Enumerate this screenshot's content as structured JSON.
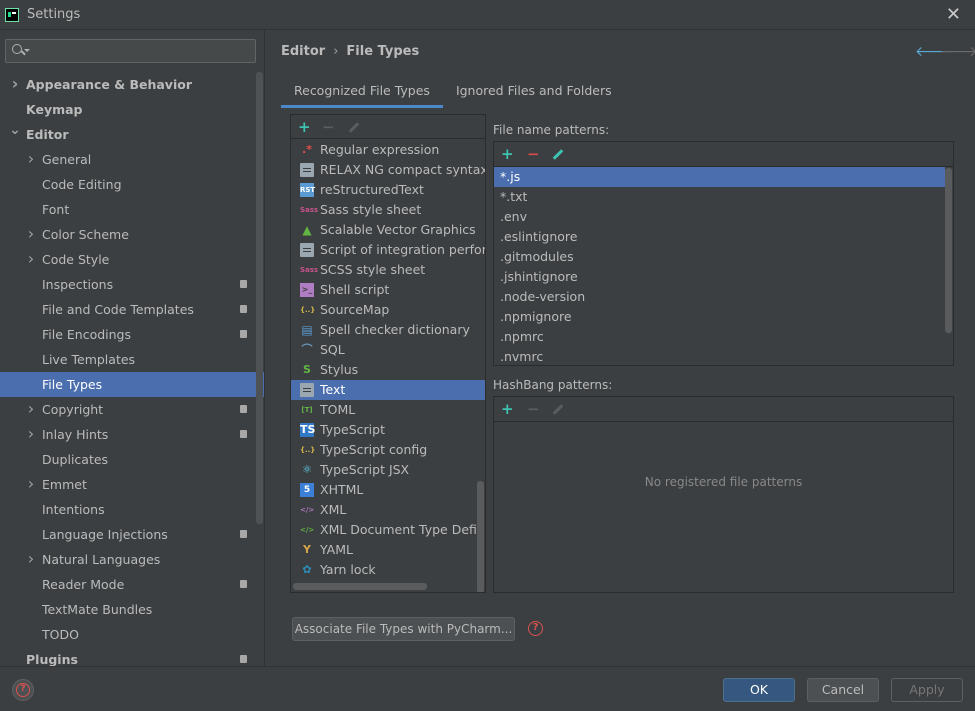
{
  "window": {
    "title": "Settings",
    "close_glyph": "✕"
  },
  "search": {
    "value": "",
    "placeholder": ""
  },
  "sidebar": {
    "items": [
      {
        "label": "Appearance & Behavior",
        "level": 0,
        "bold": true,
        "expandable": true,
        "expanded": false,
        "badge": false,
        "selected": false
      },
      {
        "label": "Keymap",
        "level": 0,
        "bold": true,
        "expandable": false,
        "badge": false,
        "selected": false
      },
      {
        "label": "Editor",
        "level": 0,
        "bold": true,
        "expandable": true,
        "expanded": true,
        "badge": false,
        "selected": false
      },
      {
        "label": "General",
        "level": 1,
        "bold": false,
        "expandable": true,
        "expanded": false,
        "badge": false,
        "selected": false
      },
      {
        "label": "Code Editing",
        "level": 1,
        "bold": false,
        "expandable": false,
        "badge": false,
        "selected": false
      },
      {
        "label": "Font",
        "level": 1,
        "bold": false,
        "expandable": false,
        "badge": false,
        "selected": false
      },
      {
        "label": "Color Scheme",
        "level": 1,
        "bold": false,
        "expandable": true,
        "expanded": false,
        "badge": false,
        "selected": false
      },
      {
        "label": "Code Style",
        "level": 1,
        "bold": false,
        "expandable": true,
        "expanded": false,
        "badge": false,
        "selected": false
      },
      {
        "label": "Inspections",
        "level": 1,
        "bold": false,
        "expandable": false,
        "badge": true,
        "selected": false
      },
      {
        "label": "File and Code Templates",
        "level": 1,
        "bold": false,
        "expandable": false,
        "badge": true,
        "selected": false
      },
      {
        "label": "File Encodings",
        "level": 1,
        "bold": false,
        "expandable": false,
        "badge": true,
        "selected": false
      },
      {
        "label": "Live Templates",
        "level": 1,
        "bold": false,
        "expandable": false,
        "badge": false,
        "selected": false
      },
      {
        "label": "File Types",
        "level": 1,
        "bold": false,
        "expandable": false,
        "badge": false,
        "selected": true
      },
      {
        "label": "Copyright",
        "level": 1,
        "bold": false,
        "expandable": true,
        "expanded": false,
        "badge": true,
        "selected": false
      },
      {
        "label": "Inlay Hints",
        "level": 1,
        "bold": false,
        "expandable": true,
        "expanded": false,
        "badge": true,
        "selected": false
      },
      {
        "label": "Duplicates",
        "level": 1,
        "bold": false,
        "expandable": false,
        "badge": false,
        "selected": false
      },
      {
        "label": "Emmet",
        "level": 1,
        "bold": false,
        "expandable": true,
        "expanded": false,
        "badge": false,
        "selected": false
      },
      {
        "label": "Intentions",
        "level": 1,
        "bold": false,
        "expandable": false,
        "badge": false,
        "selected": false
      },
      {
        "label": "Language Injections",
        "level": 1,
        "bold": false,
        "expandable": false,
        "badge": true,
        "selected": false
      },
      {
        "label": "Natural Languages",
        "level": 1,
        "bold": false,
        "expandable": true,
        "expanded": false,
        "badge": false,
        "selected": false
      },
      {
        "label": "Reader Mode",
        "level": 1,
        "bold": false,
        "expandable": false,
        "badge": true,
        "selected": false
      },
      {
        "label": "TextMate Bundles",
        "level": 1,
        "bold": false,
        "expandable": false,
        "badge": false,
        "selected": false
      },
      {
        "label": "TODO",
        "level": 1,
        "bold": false,
        "expandable": false,
        "badge": false,
        "selected": false
      },
      {
        "label": "Plugins",
        "level": 0,
        "bold": true,
        "expandable": false,
        "badge": true,
        "selected": false
      }
    ]
  },
  "breadcrumb": {
    "parent": "Editor",
    "separator": "›",
    "current": "File Types"
  },
  "nav": {
    "back": "🡐",
    "forward": "🡒"
  },
  "tabs": [
    {
      "label": "Recognized File Types",
      "active": true
    },
    {
      "label": "Ignored Files and Folders",
      "active": false
    }
  ],
  "toolbar": {
    "add": "+",
    "remove": "−"
  },
  "file_types": [
    {
      "name": "Regular expression",
      "icon": "regex-icon",
      "glyph": ".*",
      "color": "#e84d4d",
      "selected": false
    },
    {
      "name": "RELAX NG compact syntax",
      "icon": "file-icon",
      "glyph": "",
      "color": "#9aa7b0",
      "selected": false
    },
    {
      "name": "reStructuredText",
      "icon": "rst-icon",
      "glyph": "RST",
      "color": "#5a9bd4",
      "selected": false
    },
    {
      "name": "Sass style sheet",
      "icon": "sass-icon",
      "glyph": "Sass",
      "color": "#c6538c",
      "selected": false
    },
    {
      "name": "Scalable Vector Graphics",
      "icon": "image-icon",
      "glyph": "▲",
      "color": "#62b543",
      "selected": false
    },
    {
      "name": "Script of integration performance",
      "icon": "file-icon",
      "glyph": "",
      "color": "#9aa7b0",
      "selected": false
    },
    {
      "name": "SCSS style sheet",
      "icon": "scss-icon",
      "glyph": "Sass",
      "color": "#c6538c",
      "selected": false
    },
    {
      "name": "Shell script",
      "icon": "terminal-icon",
      "glyph": ">_",
      "color": "#b07cc2",
      "selected": false
    },
    {
      "name": "SourceMap",
      "icon": "json-icon",
      "glyph": "{..}",
      "color": "#d6b94a",
      "selected": false
    },
    {
      "name": "Spell checker dictionary",
      "icon": "dictionary-icon",
      "glyph": "▤",
      "color": "#5a9bd4",
      "selected": false
    },
    {
      "name": "SQL",
      "icon": "sql-icon",
      "glyph": "⌒",
      "color": "#6a96b9",
      "selected": false
    },
    {
      "name": "Stylus",
      "icon": "stylus-icon",
      "glyph": "S",
      "color": "#62b543",
      "selected": false
    },
    {
      "name": "Text",
      "icon": "file-icon",
      "glyph": "",
      "color": "#9aa7b0",
      "selected": true
    },
    {
      "name": "TOML",
      "icon": "toml-icon",
      "glyph": "[T]",
      "color": "#62b543",
      "selected": false
    },
    {
      "name": "TypeScript",
      "icon": "typescript-icon",
      "glyph": "TS",
      "color": "#3178c6",
      "selected": false
    },
    {
      "name": "TypeScript config",
      "icon": "json-icon",
      "glyph": "{..}",
      "color": "#d6b94a",
      "selected": false
    },
    {
      "name": "TypeScript JSX",
      "icon": "react-icon",
      "glyph": "⚛",
      "color": "#61dafb",
      "selected": false
    },
    {
      "name": "XHTML",
      "icon": "html5-icon",
      "glyph": "5",
      "color": "#3c7fd6",
      "selected": false
    },
    {
      "name": "XML",
      "icon": "xml-icon",
      "glyph": "</>",
      "color": "#b07cc2",
      "selected": false
    },
    {
      "name": "XML Document Type Definition",
      "icon": "dtd-icon",
      "glyph": "</>",
      "color": "#62b543",
      "selected": false
    },
    {
      "name": "YAML",
      "icon": "yaml-icon",
      "glyph": "Y",
      "color": "#d6a34a",
      "selected": false
    },
    {
      "name": "Yarn lock",
      "icon": "yarn-icon",
      "glyph": "✿",
      "color": "#2c8ebb",
      "selected": false
    }
  ],
  "file_name_patterns": {
    "label": "File name patterns:",
    "items": [
      {
        "value": "*.js",
        "selected": true
      },
      {
        "value": "*.txt",
        "selected": false
      },
      {
        "value": ".env",
        "selected": false
      },
      {
        "value": ".eslintignore",
        "selected": false
      },
      {
        "value": ".gitmodules",
        "selected": false
      },
      {
        "value": ".jshintignore",
        "selected": false
      },
      {
        "value": ".node-version",
        "selected": false
      },
      {
        "value": ".npmignore",
        "selected": false
      },
      {
        "value": ".npmrc",
        "selected": false
      },
      {
        "value": ".nvmrc",
        "selected": false
      }
    ]
  },
  "hashbang_patterns": {
    "label": "HashBang patterns:",
    "empty_text": "No registered file patterns"
  },
  "associate_button": "Associate File Types with PyCharm...",
  "help_glyph": "?",
  "footer": {
    "ok": "OK",
    "cancel": "Cancel",
    "apply": "Apply"
  },
  "colors": {
    "accent_selection": "#4b6eaf",
    "add": "#3ec2b1",
    "remove": "#d14a4a",
    "edit": "#3ec2b1",
    "help": "#d9534f"
  }
}
